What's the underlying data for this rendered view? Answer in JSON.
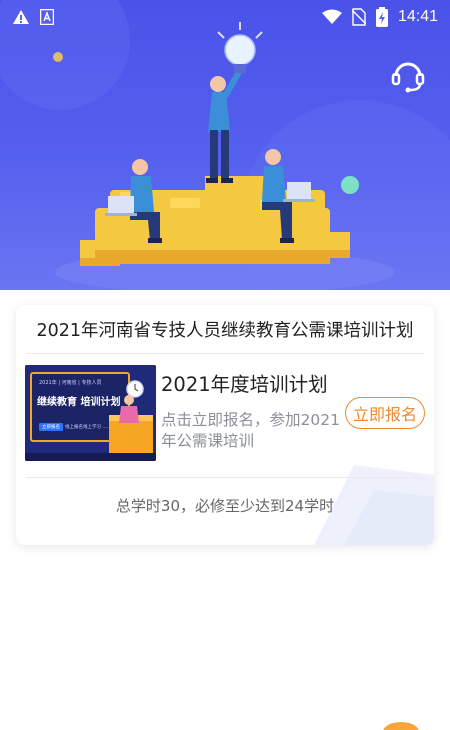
{
  "status_bar": {
    "time": "14:41",
    "icons": [
      "warning-icon",
      "keyboard-a-icon",
      "wifi-icon",
      "no-sim-icon",
      "battery-charging-icon"
    ]
  },
  "header": {
    "support_icon": "headset-icon"
  },
  "card": {
    "title": "2021年河南省专技人员继续教育公需课培训计划",
    "plan": {
      "title": "2021年度培训计划",
      "description": "点击立即报名，参加2021年公需课培训",
      "enroll_label": "立即报名",
      "thumbnail": {
        "small_text": "2021年 | 河南省 | 专技人员",
        "big_text": "继续教育  培训计划",
        "chip_text": "立即报名",
        "sub_text": "线上报名线上学习 ……"
      }
    },
    "hours_note": "总学时30，必修至少达到24学时"
  },
  "colors": {
    "hero_blue": "#5560ee",
    "accent_orange": "#f08a2e",
    "gear_yellow": "#f5c842"
  }
}
